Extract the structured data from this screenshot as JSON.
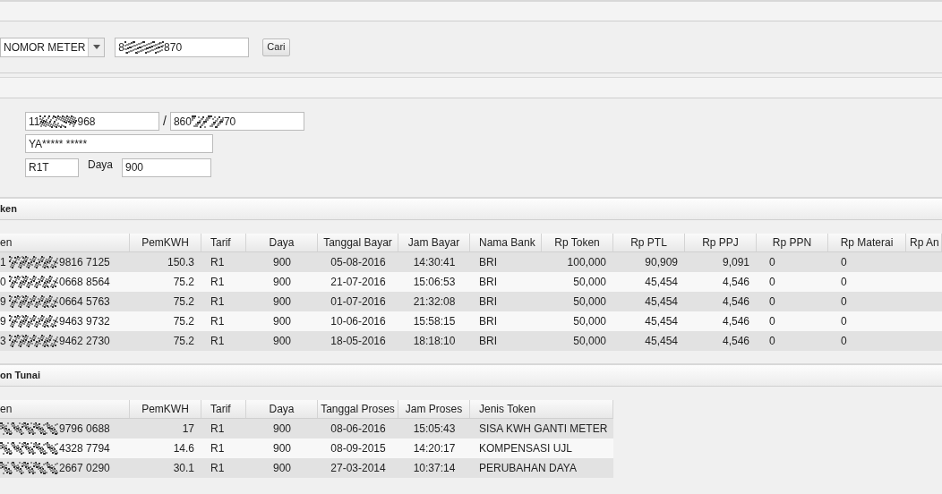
{
  "search": {
    "field_option": "NOMOR METER",
    "query_prefix": "8",
    "query_suffix": "870",
    "button": "Cari"
  },
  "customer": {
    "id_prefix": "11",
    "id_suffix": "968",
    "separator": "/",
    "meter_prefix": "860",
    "meter_suffix": "70",
    "name": "YA***** *****",
    "tarif": "R1T",
    "daya_label": "Daya",
    "daya": "900"
  },
  "token_section": {
    "title": "ken",
    "columns": [
      "en",
      "PemKWH",
      "Tarif",
      "Daya",
      "Tanggal Bayar",
      "Jam Bayar",
      "Nama Bank",
      "Rp Token",
      "Rp PTL",
      "Rp PPJ",
      "Rp PPN",
      "Rp Materai",
      "Rp An"
    ],
    "rows": [
      {
        "token_prefix": "1",
        "cells": [
          "9816 7125",
          "150.3",
          "R1",
          "900",
          "05-08-2016",
          "14:30:41",
          "BRI",
          "100,000",
          "90,909",
          "9,091",
          "0",
          "0"
        ]
      },
      {
        "token_prefix": "0",
        "cells": [
          "0668 8564",
          "75.2",
          "R1",
          "900",
          "21-07-2016",
          "15:06:53",
          "BRI",
          "50,000",
          "45,454",
          "4,546",
          "0",
          "0"
        ]
      },
      {
        "token_prefix": "9",
        "cells": [
          "0664 5763",
          "75.2",
          "R1",
          "900",
          "01-07-2016",
          "21:32:08",
          "BRI",
          "50,000",
          "45,454",
          "4,546",
          "0",
          "0"
        ]
      },
      {
        "token_prefix": "9",
        "cells": [
          "9463 9732",
          "75.2",
          "R1",
          "900",
          "10-06-2016",
          "15:58:15",
          "BRI",
          "50,000",
          "45,454",
          "4,546",
          "0",
          "0"
        ]
      },
      {
        "token_prefix": "3",
        "cells": [
          "9462 2730",
          "75.2",
          "R1",
          "900",
          "18-05-2016",
          "18:18:10",
          "BRI",
          "50,000",
          "45,454",
          "4,546",
          "0",
          "0"
        ]
      }
    ]
  },
  "non_cash_section": {
    "title": "on Tunai",
    "columns": [
      "en",
      "PemKWH",
      "Tarif",
      "Daya",
      "Tanggal Proses",
      "Jam Proses",
      "Jenis Token"
    ],
    "rows": [
      {
        "cells": [
          "9796 0688",
          "17",
          "R1",
          "900",
          "08-06-2016",
          "15:05:43",
          "SISA KWH GANTI METER"
        ]
      },
      {
        "cells": [
          "4328 7794",
          "14.6",
          "R1",
          "900",
          "08-09-2015",
          "14:20:17",
          "KOMPENSASI UJL"
        ]
      },
      {
        "cells": [
          "2667 0290",
          "30.1",
          "R1",
          "900",
          "27-03-2014",
          "10:37:14",
          "PERUBAHAN DAYA"
        ]
      }
    ]
  }
}
